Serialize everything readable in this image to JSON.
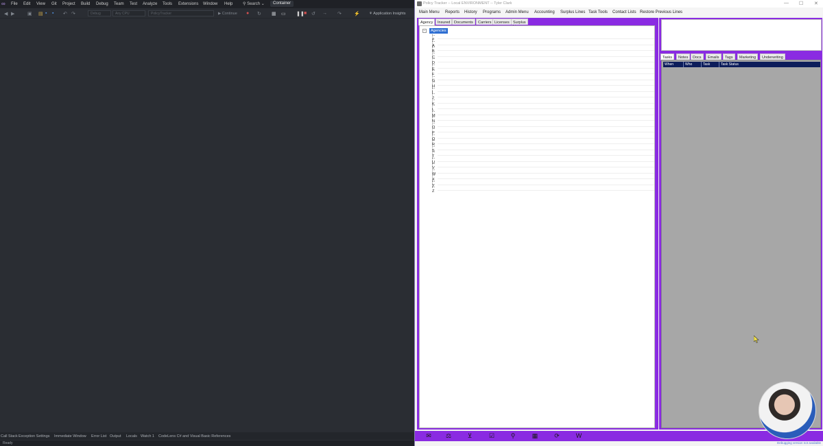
{
  "vs": {
    "menu": [
      "File",
      "Edit",
      "View",
      "Git",
      "Project",
      "Build",
      "Debug",
      "Team",
      "Test",
      "Analyze",
      "Tools",
      "Extensions",
      "Window",
      "Help"
    ],
    "search_label": "Search",
    "search_chevron": "⌄",
    "container_label": "Container",
    "toolbar": {
      "config_field": "Debug",
      "platform_field": "Any CPU",
      "startup_field": "PolicyTracker",
      "continue_label": "Continue",
      "insights_label": "Application Insights"
    },
    "bottom_tabs": [
      "Call Stack",
      "Exception Settings",
      "Immediate Window",
      "Error List",
      "Output",
      "Locals",
      "Watch 1",
      "CodeLens C# and Visual Basic References"
    ],
    "status": "Ready"
  },
  "policy_tracker": {
    "window_title": "Policy Tracker -- Local ENVIRONMENT -- Tyler Clark",
    "window_controls": {
      "minimize": "—",
      "maximize": "☐",
      "close": "✕"
    },
    "menu": [
      "Main Menu",
      "Reports",
      "History",
      "Programs",
      "Admin Menu",
      "Accounting",
      "Surplus Lines",
      "Task Tools",
      "Contact Lists",
      "Restore Previous Lines"
    ],
    "left_tabs": [
      "Agency",
      "Insured",
      "Documents",
      "Carriers",
      "Licenses",
      "Surplus Lines"
    ],
    "active_left_tab": "Agency",
    "tree": {
      "root": "Agencies",
      "expander": "−",
      "nodes": [
        "#",
        "A",
        "B",
        "C",
        "D",
        "E",
        "F",
        "G",
        "H",
        "I",
        "J",
        "K",
        "L",
        "M",
        "N",
        "O",
        "P",
        "Q",
        "R",
        "S",
        "T",
        "U",
        "V",
        "W",
        "X",
        "Y",
        "Z"
      ]
    },
    "right_tabs": [
      "Tasks",
      "Notes",
      "Docs",
      "Emails",
      "Tags",
      "Marketing",
      "Underwriting"
    ],
    "active_right_tab": "Tasks",
    "grid_columns": [
      "When",
      "Who",
      "Task",
      "Task Status"
    ],
    "bottom_icons": [
      "mail-icon",
      "scales-icon",
      "inbox-icon",
      "checklist-icon",
      "magnifier-icon",
      "calendar-icon",
      "refresh-icon",
      "word-icon"
    ],
    "status_right": "Debugging version not available"
  },
  "colors": {
    "accent_purple": "#8a2be2",
    "grid_header": "#0c1c5a",
    "selected_node": "#2f6fd2",
    "vs_background": "#2a2d33"
  }
}
